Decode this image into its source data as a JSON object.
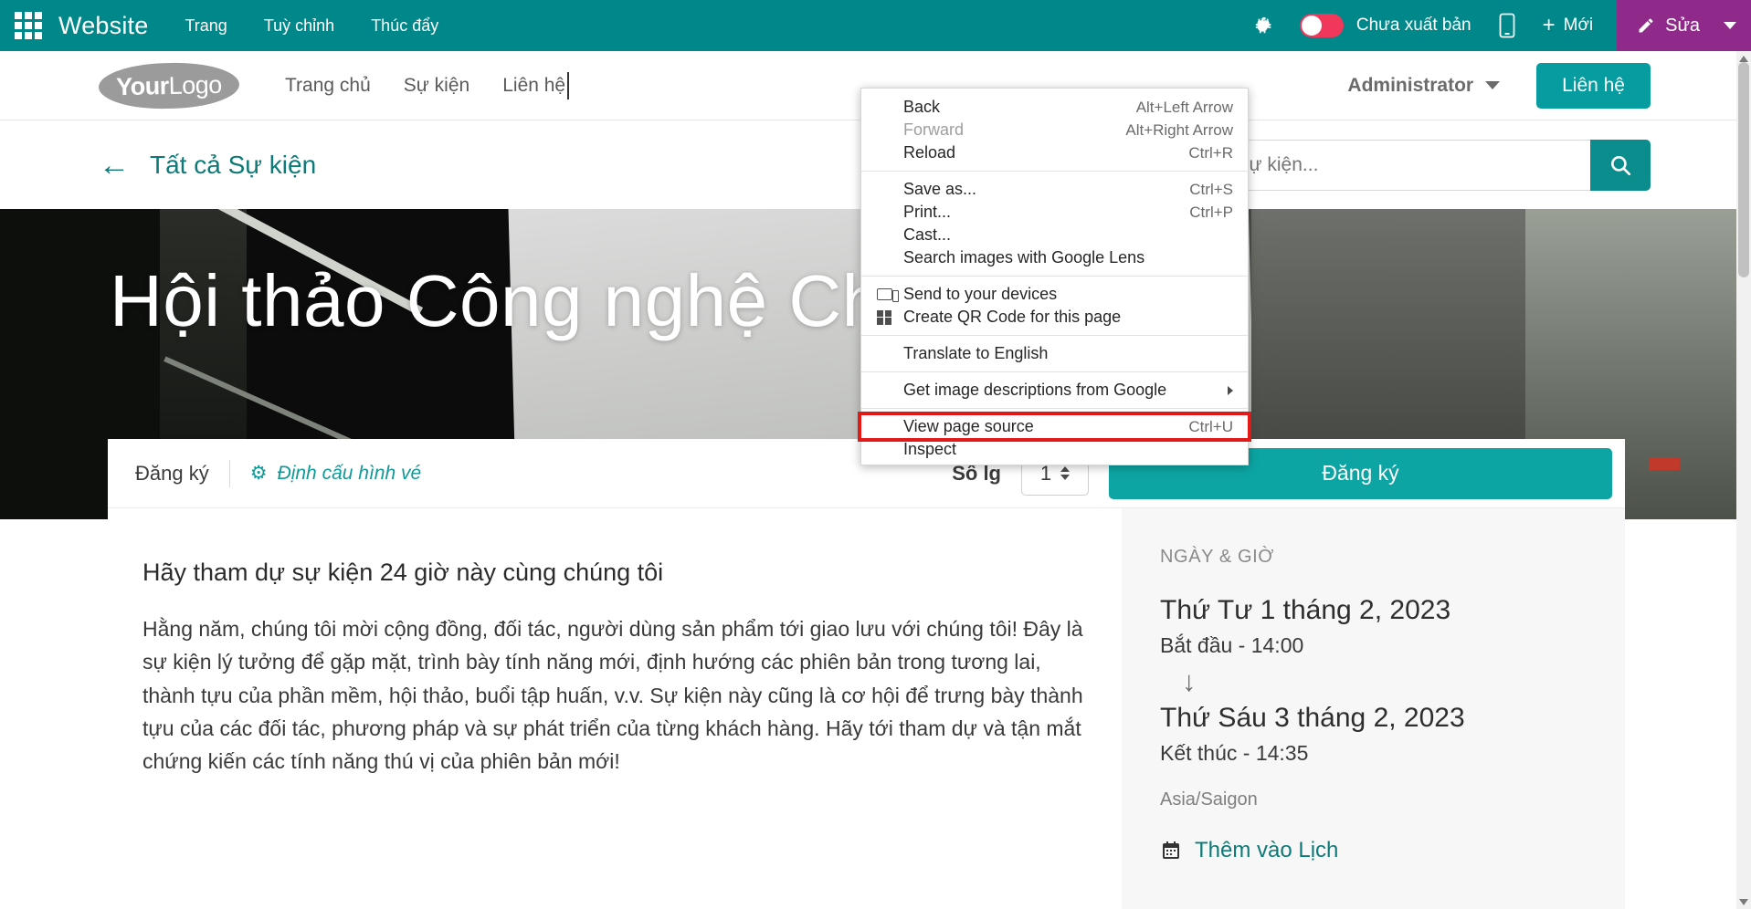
{
  "odoo_bar": {
    "apps_icon": "apps-grid-icon",
    "brand": "Website",
    "menu": [
      "Trang",
      "Tuỳ chỉnh",
      "Thúc đẩy"
    ],
    "bug_icon": "bug-icon",
    "publish_label": "Chưa xuất bản",
    "mobile_icon": "mobile-preview-icon",
    "new_label": "Mới",
    "edit_label": "Sửa",
    "accent_teal": "#00878a",
    "accent_purple": "#8f2a8b",
    "toggle_red": "#f2385a"
  },
  "site_header": {
    "logo_your": "Your",
    "logo_logo": "Logo",
    "nav": [
      "Trang chủ",
      "Sự kiện",
      "Liên hệ"
    ],
    "admin_label": "Administrator",
    "contact_label": "Liên hệ"
  },
  "sub_bar": {
    "back_arrow": "←",
    "back_label": "Tất cả Sự kiện",
    "search_placeholder": "Tìm kiếm một sự kiện...",
    "search_value": "",
    "search_icon": "search-icon"
  },
  "hero": {
    "title": "Hội thảo Công nghệ Chu"
  },
  "registration": {
    "title": "Đăng ký",
    "configure_label": "Định cấu hình vé",
    "gear_icon": "gear-icon",
    "qty_label": "Số lg",
    "qty_value": "1",
    "submit_label": "Đăng ký"
  },
  "body": {
    "heading": "Hãy tham dự sự kiện 24 giờ này cùng chúng tôi",
    "paragraph": "Hằng năm, chúng tôi mời cộng đồng, đối tác, người dùng sản phẩm tới giao lưu với chúng tôi! Đây là sự kiện lý tưởng để gặp mặt, trình bày tính năng mới, định hướng các phiên bản trong tương lai, thành tựu của phần mềm, hội thảo, buổi tập huấn, v.v. Sự kiện này cũng là cơ hội để trưng bày thành tựu của các đối tác, phương pháp và sự phát triển của từng khách hàng. Hãy tới tham dự và tận mắt chứng kiến các tính năng thú vị của phiên bản mới!"
  },
  "sidebar": {
    "label": "NGÀY & GIỜ",
    "start_date": "Thứ Tư 1 tháng 2, 2023",
    "start_time": "Bắt đầu - 14:00",
    "arrow": "↓",
    "end_date": "Thứ Sáu 3 tháng 2, 2023",
    "end_time": "Kết thúc - 14:35",
    "timezone": "Asia/Saigon",
    "calendar_icon": "calendar-icon",
    "calendar_label": "Thêm vào Lịch"
  },
  "context_menu": {
    "items": [
      {
        "label": "Back",
        "shortcut": "Alt+Left Arrow",
        "icon": null,
        "disabled": false,
        "highlighted": false,
        "submenu": false
      },
      {
        "label": "Forward",
        "shortcut": "Alt+Right Arrow",
        "icon": null,
        "disabled": true,
        "highlighted": false,
        "submenu": false
      },
      {
        "label": "Reload",
        "shortcut": "Ctrl+R",
        "icon": null,
        "disabled": false,
        "highlighted": false,
        "submenu": false
      },
      {
        "label": "Save as...",
        "shortcut": "Ctrl+S",
        "icon": null,
        "disabled": false,
        "highlighted": false,
        "submenu": false
      },
      {
        "label": "Print...",
        "shortcut": "Ctrl+P",
        "icon": null,
        "disabled": false,
        "highlighted": false,
        "submenu": false
      },
      {
        "label": "Cast...",
        "shortcut": "",
        "icon": null,
        "disabled": false,
        "highlighted": false,
        "submenu": false
      },
      {
        "label": "Search images with Google Lens",
        "shortcut": "",
        "icon": null,
        "disabled": false,
        "highlighted": false,
        "submenu": false
      },
      {
        "label": "Send to your devices",
        "shortcut": "",
        "icon": "send-to-devices-icon",
        "disabled": false,
        "highlighted": false,
        "submenu": false
      },
      {
        "label": "Create QR Code for this page",
        "shortcut": "",
        "icon": "qr-code-icon",
        "disabled": false,
        "highlighted": false,
        "submenu": false
      },
      {
        "label": "Translate to English",
        "shortcut": "",
        "icon": null,
        "disabled": false,
        "highlighted": false,
        "submenu": false
      },
      {
        "label": "Get image descriptions from Google",
        "shortcut": "",
        "icon": null,
        "disabled": false,
        "highlighted": false,
        "submenu": true
      },
      {
        "label": "View page source",
        "shortcut": "Ctrl+U",
        "icon": null,
        "disabled": false,
        "highlighted": true,
        "submenu": false
      },
      {
        "label": "Inspect",
        "shortcut": "",
        "icon": null,
        "disabled": false,
        "highlighted": false,
        "submenu": false
      }
    ],
    "separators_after": [
      2,
      6,
      8,
      9,
      10
    ],
    "highlight_color": "#e11919"
  }
}
